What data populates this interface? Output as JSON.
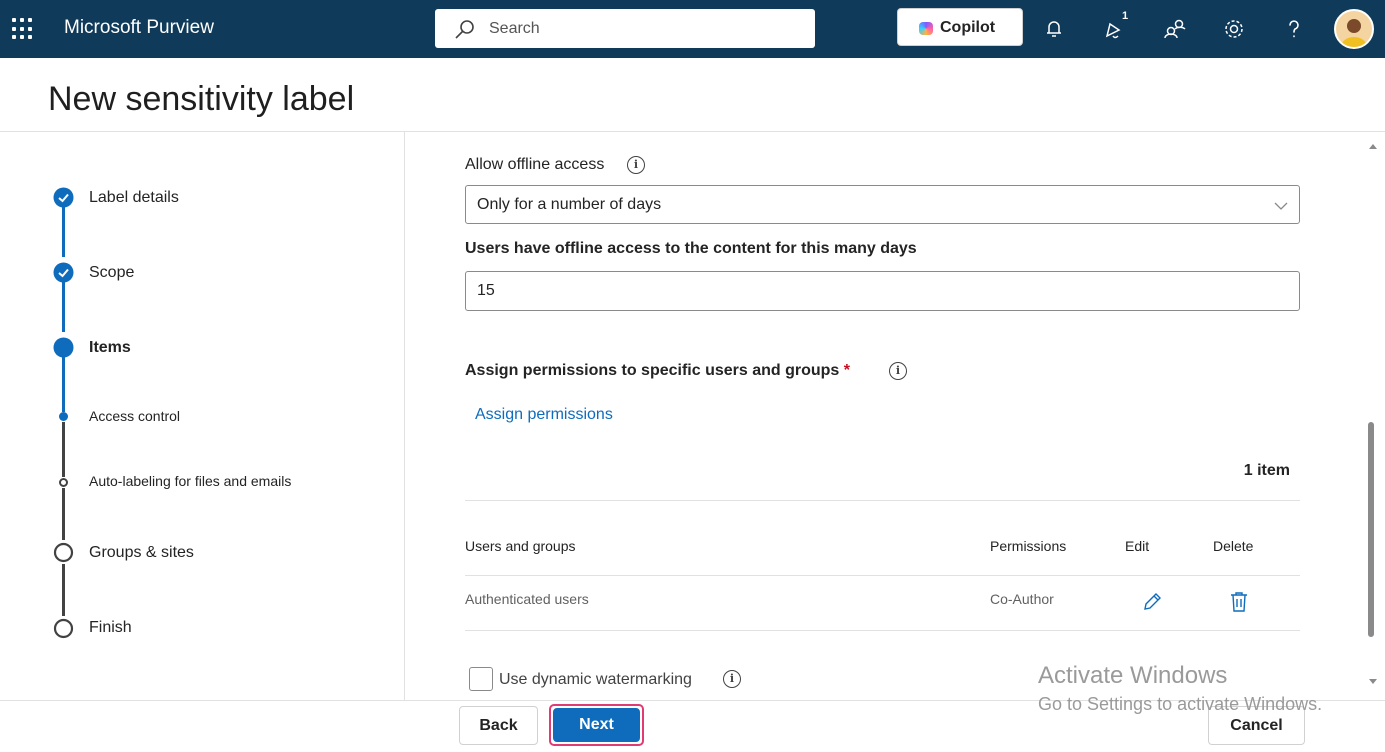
{
  "topbar": {
    "app_name": "Microsoft Purview",
    "search_placeholder": "Search",
    "copilot_label": "Copilot",
    "notification_count": "1"
  },
  "page": {
    "title": "New sensitivity label"
  },
  "steps": [
    {
      "label": "Label details",
      "state": "completed"
    },
    {
      "label": "Scope",
      "state": "completed"
    },
    {
      "label": "Items",
      "state": "current"
    },
    {
      "label": "Access control",
      "state": "current-substep"
    },
    {
      "label": "Auto-labeling for files and emails",
      "state": "pending-substep"
    },
    {
      "label": "Groups & sites",
      "state": "pending"
    },
    {
      "label": "Finish",
      "state": "pending"
    }
  ],
  "form": {
    "offline_access_label": "Allow offline access",
    "offline_access_value": "Only for a number of days",
    "days_label": "Users have offline access to the content for this many days",
    "days_value": "15",
    "assign_label": "Assign permissions to specific users and groups",
    "required_mark": "*",
    "assign_link": "Assign permissions",
    "item_count": "1 item",
    "table": {
      "headers": [
        "Users and groups",
        "Permissions",
        "Edit",
        "Delete"
      ],
      "rows": [
        {
          "user": "Authenticated users",
          "permission": "Co-Author"
        }
      ]
    },
    "watermark_label": "Use dynamic watermarking"
  },
  "footer": {
    "back_label": "Back",
    "next_label": "Next",
    "cancel_label": "Cancel"
  },
  "os_watermark": {
    "line1": "Activate Windows",
    "line2": "Go to Settings to activate Windows."
  },
  "colors": {
    "header_bg": "#0f3a5a",
    "accent": "#0f6cbd",
    "highlight": "#e03c74",
    "required": "#c50f1f"
  }
}
